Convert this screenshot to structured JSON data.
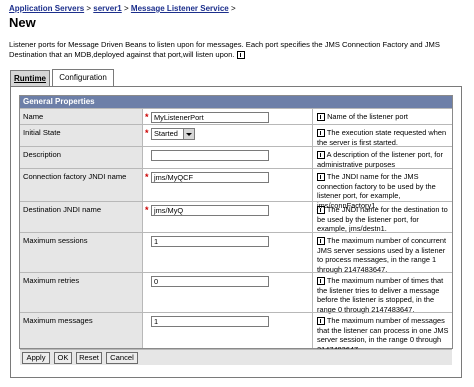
{
  "breadcrumb": {
    "items": [
      "Application Servers",
      "server1",
      "Message Listener Service"
    ],
    "separator": ">"
  },
  "page_title": "New",
  "description": "Listener ports for Message Driven Beans to listen upon for messages. Each port specifies the JMS Connection Factory and JMS Destination that an MDB,deployed against that port,will listen upon.",
  "tabs": {
    "runtime": "Runtime",
    "configuration": "Configuration"
  },
  "section_title": "General Properties",
  "fields": [
    {
      "label": "Name",
      "required": true,
      "value": "MyListenerPort",
      "help": "Name of the listener port"
    },
    {
      "label": "Initial State",
      "required": true,
      "value": "Started",
      "help": "The execution state requested when the server is first started."
    },
    {
      "label": "Description",
      "required": false,
      "value": "",
      "help": "A description of the listener port, for administrative purposes"
    },
    {
      "label": "Connection factory JNDI name",
      "required": true,
      "value": "jms/MyQCF",
      "help": "The JNDI name for the JMS connection factory to be used by the listener port, for example, jms/connFactory1."
    },
    {
      "label": "Destination JNDI name",
      "required": true,
      "value": "jms/MyQ",
      "help": "The JNDI name for the destination to be used by the listener port, for example, jms/destn1."
    },
    {
      "label": "Maximum sessions",
      "required": false,
      "value": "1",
      "help": "The maximum number of concurrent JMS server sessions used by a listener to process messages, in the range 1 through 2147483647."
    },
    {
      "label": "Maximum retries",
      "required": false,
      "value": "0",
      "help": "The maximum number of times that the listener tries to deliver a message before the listener is stopped, in the range 0 through 2147483647."
    },
    {
      "label": "Maximum messages",
      "required": false,
      "value": "1",
      "help": "The maximum number of messages that the listener can process in one JMS server session, in the range 0 through 2147483647."
    }
  ],
  "buttons": {
    "apply": "Apply",
    "ok": "OK",
    "reset": "Reset",
    "cancel": "Cancel"
  },
  "required_marker": "*",
  "colors": {
    "section_header": "#6d7fa8",
    "required": "#cc0000",
    "link": "#1c2f8c"
  }
}
